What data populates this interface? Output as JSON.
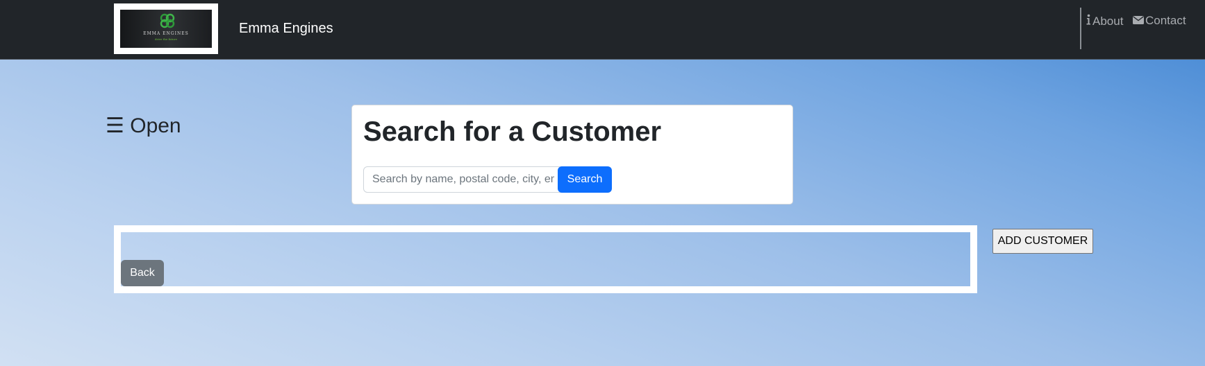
{
  "navbar": {
    "logo": {
      "text": "EMMA ENGINES",
      "tagline": "drive the future",
      "accent_color": "#2e9a3a"
    },
    "brand": "Emma Engines",
    "links": [
      {
        "label": "About",
        "icon": "info-icon"
      },
      {
        "label": "Contact",
        "icon": "envelope-icon"
      }
    ],
    "background": "#212529"
  },
  "sidebar_toggle": {
    "label": "☰ Open"
  },
  "search": {
    "title": "Search for a Customer",
    "placeholder": "Search by name, postal code, city, email",
    "value": "",
    "button_label": "Search",
    "button_color": "#0d6efd"
  },
  "results": {
    "back_label": "Back",
    "back_color": "#6c757d"
  },
  "add_customer": {
    "label": "ADD CUSTOMER"
  }
}
